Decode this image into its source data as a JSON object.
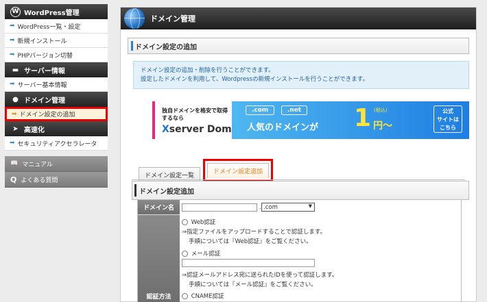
{
  "sidebar": {
    "sections": [
      {
        "title": "WordPress管理",
        "items": [
          "WordPress一覧・設定",
          "新規インストール",
          "PHPバージョン切替"
        ]
      },
      {
        "title": "サーバー情報",
        "items": [
          "サーバー基本情報"
        ]
      },
      {
        "title": "ドメイン管理",
        "items": [
          "ドメイン設定の追加"
        ]
      },
      {
        "title": "高速化",
        "items": [
          "セキュリティアクセラレータ"
        ]
      }
    ],
    "bottom": [
      "マニュアル",
      "よくある質問"
    ]
  },
  "main": {
    "title": "ドメイン管理",
    "subtitle": "ドメイン設定の追加",
    "info": [
      "ドメイン設定の追加・削除を行うことができます。",
      "設定したドメインを利用して、Wordpressの新規インストールを行うことができます。"
    ],
    "banner": {
      "line1": "独自ドメインを格安で取得するなら",
      "brand_x": "X",
      "brand_rest": "server Domain",
      "tld1": ".com",
      "tld2": ".net",
      "text": "人気のドメインが",
      "price": "1",
      "tax": "(税込)",
      "yen": "円〜",
      "official": "公式\nサイトは\nこちら"
    },
    "tabs": [
      "ドメイン設定一覧",
      "ドメイン設定追加"
    ],
    "section_title": "ドメイン設定追加",
    "form": {
      "domain_label": "ドメイン名",
      "domain_value": "",
      "tld_select": ".com",
      "auth_label": "認証方法",
      "web_auth": "Web認証",
      "web_desc": "⇒指定ファイルをアップロードすることで認証します。",
      "web_help": "手順については『Web認証』をご覧ください。",
      "mail_auth": "メール認証",
      "mail_value": "",
      "mail_desc": "⇒認証メールアドレス宛に送られたIDを使って認証します。",
      "mail_help": "手順については『メール認証』をご覧ください。",
      "cname_auth": "CNAME認証"
    }
  }
}
